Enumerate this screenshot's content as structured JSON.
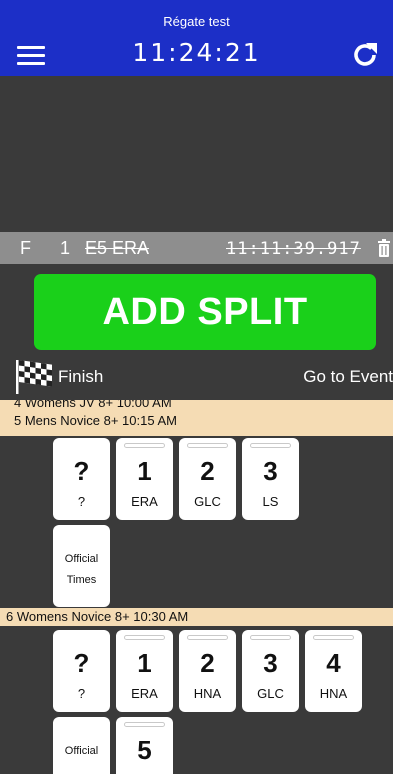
{
  "header": {
    "regatta_name": "Régate test",
    "clock": "11:24:21",
    "menu_icon": "hamburger-menu-icon",
    "refresh_icon": "refresh-icon"
  },
  "last_split": {
    "type": "F",
    "number": "1",
    "crew": "E5 ERA",
    "time": "11:11:39.917",
    "delete_icon": "trash-icon"
  },
  "add_split": {
    "label": "ADD SPLIT",
    "color": "#1ad01a"
  },
  "finish_bar": {
    "finish_label": "Finish",
    "goto_label": "Go to Event",
    "flag_icon": "checkered-flag-icon"
  },
  "events": [
    {
      "cut_header": "4 Womens JV 8+ 10:00 AM",
      "header": "5 Mens Novice 8+ 10:15 AM",
      "cards": [
        {
          "top": "?",
          "bottom": "?"
        },
        {
          "top": "1",
          "bottom": "ERA"
        },
        {
          "top": "2",
          "bottom": "GLC"
        },
        {
          "top": "3",
          "bottom": "LS"
        }
      ],
      "official": {
        "line1": "Official",
        "line2": "Times"
      }
    },
    {
      "header": "6 Womens Novice 8+ 10:30 AM",
      "cards": [
        {
          "top": "?",
          "bottom": "?"
        },
        {
          "top": "1",
          "bottom": "ERA"
        },
        {
          "top": "2",
          "bottom": "HNA"
        },
        {
          "top": "3",
          "bottom": "GLC"
        },
        {
          "top": "4",
          "bottom": "HNA"
        },
        {
          "top": "5",
          "bottom": ""
        }
      ],
      "official": {
        "line1": "Official",
        "line2": ""
      }
    }
  ],
  "colors": {
    "header_bg": "#1c2fc7",
    "background": "#3a3a3a",
    "split_row_bg": "#8e8e8e",
    "event_band_bg": "#f5dcb4"
  }
}
